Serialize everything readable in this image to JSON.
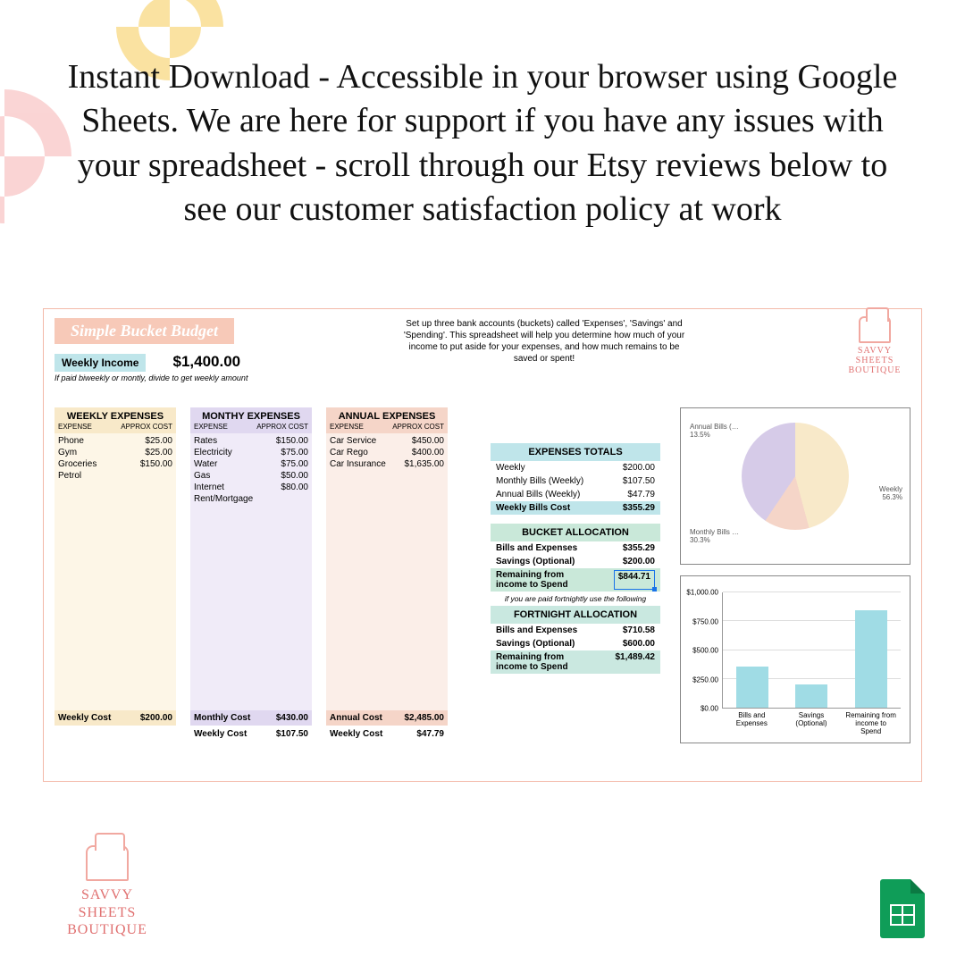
{
  "headline": "Instant Download - Accessible in your browser using Google Sheets. We are here for support if you have any issues with your spreadsheet - scroll through our Etsy reviews below to see our customer satisfaction policy at work",
  "sheet": {
    "title": "Simple Bucket Budget",
    "blurb": "Set up three bank accounts (buckets) called 'Expenses', 'Savings' and 'Spending'. This spreadsheet will help you determine how much of your income to put aside for your expenses, and how much remains to be saved or spent!",
    "logo": {
      "line1": "SAVVY SHEETS",
      "line2": "BOUTIQUE"
    },
    "income": {
      "label": "Weekly Income",
      "value": "$1,400.00",
      "note": "If paid biweekly or montly, divide to get weekly amount"
    },
    "columns_sub": {
      "left": "EXPENSE",
      "right": "APPROX COST"
    },
    "weekly": {
      "heading": "WEEKLY EXPENSES",
      "items": [
        {
          "name": "Phone",
          "cost": "$25.00"
        },
        {
          "name": "Gym",
          "cost": "$25.00"
        },
        {
          "name": "Groceries",
          "cost": "$150.00"
        },
        {
          "name": "Petrol",
          "cost": ""
        }
      ],
      "totals": [
        {
          "label": "Weekly Cost",
          "value": "$200.00"
        }
      ]
    },
    "monthly": {
      "heading": "MONTHY EXPENSES",
      "items": [
        {
          "name": "Rates",
          "cost": "$150.00"
        },
        {
          "name": "Electricity",
          "cost": "$75.00"
        },
        {
          "name": "Water",
          "cost": "$75.00"
        },
        {
          "name": "Gas",
          "cost": "$50.00"
        },
        {
          "name": "Internet",
          "cost": "$80.00"
        },
        {
          "name": "Rent/Mortgage",
          "cost": ""
        }
      ],
      "totals": [
        {
          "label": "Monthly Cost",
          "value": "$430.00"
        },
        {
          "label": "Weekly Cost",
          "value": "$107.50"
        }
      ]
    },
    "annual": {
      "heading": "ANNUAL EXPENSES",
      "items": [
        {
          "name": "Car Service",
          "cost": "$450.00"
        },
        {
          "name": "Car Rego",
          "cost": "$400.00"
        },
        {
          "name": "Car Insurance",
          "cost": "$1,635.00"
        }
      ],
      "totals": [
        {
          "label": "Annual Cost",
          "value": "$2,485.00"
        },
        {
          "label": "Weekly Cost",
          "value": "$47.79"
        }
      ]
    },
    "expenses_totals": {
      "heading": "EXPENSES TOTALS",
      "rows": [
        {
          "label": "Weekly",
          "value": "$200.00"
        },
        {
          "label": "Monthly Bills (Weekly)",
          "value": "$107.50"
        },
        {
          "label": "Annual Bills (Weekly)",
          "value": "$47.79"
        },
        {
          "label": "Weekly Bills Cost",
          "value": "$355.29"
        }
      ]
    },
    "bucket": {
      "heading": "BUCKET ALLOCATION",
      "rows": [
        {
          "label": "Bills and Expenses",
          "value": "$355.29"
        },
        {
          "label": "Savings (Optional)",
          "value": "$200.00"
        },
        {
          "label": "Remaining from income to Spend",
          "value": "$844.71"
        }
      ],
      "note": "if you are paid fortnightly use the following"
    },
    "fortnight": {
      "heading": "FORTNIGHT ALLOCATION",
      "rows": [
        {
          "label": "Bills and Expenses",
          "value": "$710.58"
        },
        {
          "label": "Savings (Optional)",
          "value": "$600.00"
        },
        {
          "label": "Remaining from income to Spend",
          "value": "$1,489.42"
        }
      ]
    }
  },
  "footer_logo": {
    "line1": "SAVVY SHEETS",
    "line2": "BOUTIQUE"
  },
  "chart_data": [
    {
      "type": "pie",
      "title": "",
      "series": [
        {
          "name": "Weekly",
          "value": 56.3,
          "label": "Weekly\n56.3%"
        },
        {
          "name": "Annual Bills (…",
          "value": 13.5,
          "label": "Annual Bills (…\n13.5%"
        },
        {
          "name": "Monthly Bills …",
          "value": 30.3,
          "label": "Monthly Bills …\n30.3%"
        }
      ]
    },
    {
      "type": "bar",
      "categories": [
        "Bills and Expenses",
        "Savings (Optional)",
        "Remaining from income to Spend"
      ],
      "values": [
        355.29,
        200.0,
        844.71
      ],
      "ylabel": "",
      "ylim": [
        0,
        1000
      ],
      "yticks": [
        "$0.00",
        "$250.00",
        "$500.00",
        "$750.00",
        "$1,000.00"
      ]
    }
  ]
}
